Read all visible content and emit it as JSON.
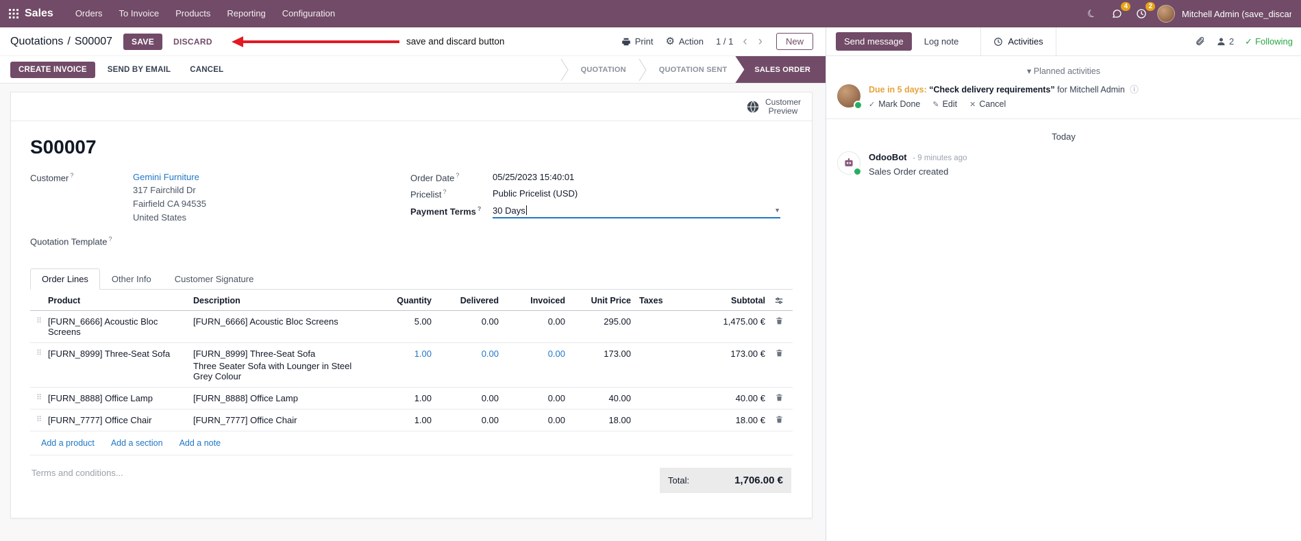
{
  "icons": {
    "help": "?",
    "moon": "☾",
    "prev": "‹",
    "next": "›",
    "gear": "⚙",
    "caret_down": "▾",
    "select_caret": "▼",
    "drag": "⠿",
    "check": "✓",
    "edit": "✎",
    "cancel": "✕",
    "info": "ⓘ"
  },
  "navbar": {
    "app_name": "Sales",
    "menus": [
      "Orders",
      "To Invoice",
      "Products",
      "Reporting",
      "Configuration"
    ],
    "message_badge": "4",
    "activity_badge": "2",
    "user_name": "Mitchell Admin (save_discar"
  },
  "control_bar": {
    "breadcrumb_parent": "Quotations",
    "breadcrumb_sep": "/",
    "breadcrumb_current": "S00007",
    "save": "SAVE",
    "discard": "DISCARD",
    "annotation": "save and discard button",
    "print": "Print",
    "action": "Action",
    "pager": "1 / 1",
    "new": "New"
  },
  "status_bar": {
    "create_invoice": "CREATE INVOICE",
    "send_by_email": "SEND BY EMAIL",
    "cancel": "CANCEL",
    "stages": [
      "QUOTATION",
      "QUOTATION SENT",
      "SALES ORDER"
    ]
  },
  "sheet": {
    "preview_line1": "Customer",
    "preview_line2": "Preview",
    "title": "S00007",
    "fields": {
      "customer_label": "Customer",
      "customer_value": "Gemini Furniture",
      "address_line1": "317 Fairchild Dr",
      "address_line2": "Fairfield CA 94535",
      "address_line3": "United States",
      "quotation_template_label": "Quotation Template",
      "order_date_label": "Order Date",
      "order_date_value": "05/25/2023 15:40:01",
      "pricelist_label": "Pricelist",
      "pricelist_value": "Public Pricelist (USD)",
      "payment_terms_label": "Payment Terms",
      "payment_terms_value": "30 Days"
    },
    "tabs": {
      "order_lines": "Order Lines",
      "other_info": "Other Info",
      "customer_signature": "Customer Signature"
    },
    "table": {
      "headers": {
        "product": "Product",
        "description": "Description",
        "quantity": "Quantity",
        "delivered": "Delivered",
        "invoiced": "Invoiced",
        "unit_price": "Unit Price",
        "taxes": "Taxes",
        "subtotal": "Subtotal"
      },
      "rows": [
        {
          "product": "[FURN_6666] Acoustic Bloc Screens",
          "desc1": "[FURN_6666] Acoustic Bloc Screens",
          "desc2": "",
          "qty": "5.00",
          "delivered": "0.00",
          "invoiced": "0.00",
          "price": "295.00",
          "taxes": "",
          "subtotal": "1,475.00 €"
        },
        {
          "product": "[FURN_8999] Three-Seat Sofa",
          "desc1": "[FURN_8999] Three-Seat Sofa",
          "desc2": "Three Seater Sofa with Lounger in Steel Grey Colour",
          "qty": "1.00",
          "delivered": "0.00",
          "invoiced": "0.00",
          "price": "173.00",
          "taxes": "",
          "subtotal": "173.00 €"
        },
        {
          "product": "[FURN_8888] Office Lamp",
          "desc1": "[FURN_8888] Office Lamp",
          "desc2": "",
          "qty": "1.00",
          "delivered": "0.00",
          "invoiced": "0.00",
          "price": "40.00",
          "taxes": "",
          "subtotal": "40.00 €"
        },
        {
          "product": "[FURN_7777] Office Chair",
          "desc1": "[FURN_7777] Office Chair",
          "desc2": "",
          "qty": "1.00",
          "delivered": "0.00",
          "invoiced": "0.00",
          "price": "18.00",
          "taxes": "",
          "subtotal": "18.00 €"
        }
      ],
      "add_product": "Add a product",
      "add_section": "Add a section",
      "add_note": "Add a note"
    },
    "terms_placeholder": "Terms and conditions...",
    "total_label": "Total:",
    "total_value": "1,706.00 €"
  },
  "chatter": {
    "send_message": "Send message",
    "log_note": "Log note",
    "activities_tab": "Activities",
    "followers_count": "2",
    "following": "Following",
    "planned_header": "Planned activities",
    "activity": {
      "due": "Due in 5 days:",
      "summary": "“Check delivery requirements”",
      "assignee": "for Mitchell Admin",
      "mark_done": "Mark Done",
      "edit": "Edit",
      "cancel": "Cancel"
    },
    "today": "Today",
    "message": {
      "author": "OdooBot",
      "time": "- 9 minutes ago",
      "body": "Sales Order created"
    }
  },
  "colors": {
    "primary": "#714B67",
    "link": "#2077c7",
    "due_warning": "#e8a33d",
    "following_green": "#28a745",
    "annotation_red": "#e01b24"
  }
}
